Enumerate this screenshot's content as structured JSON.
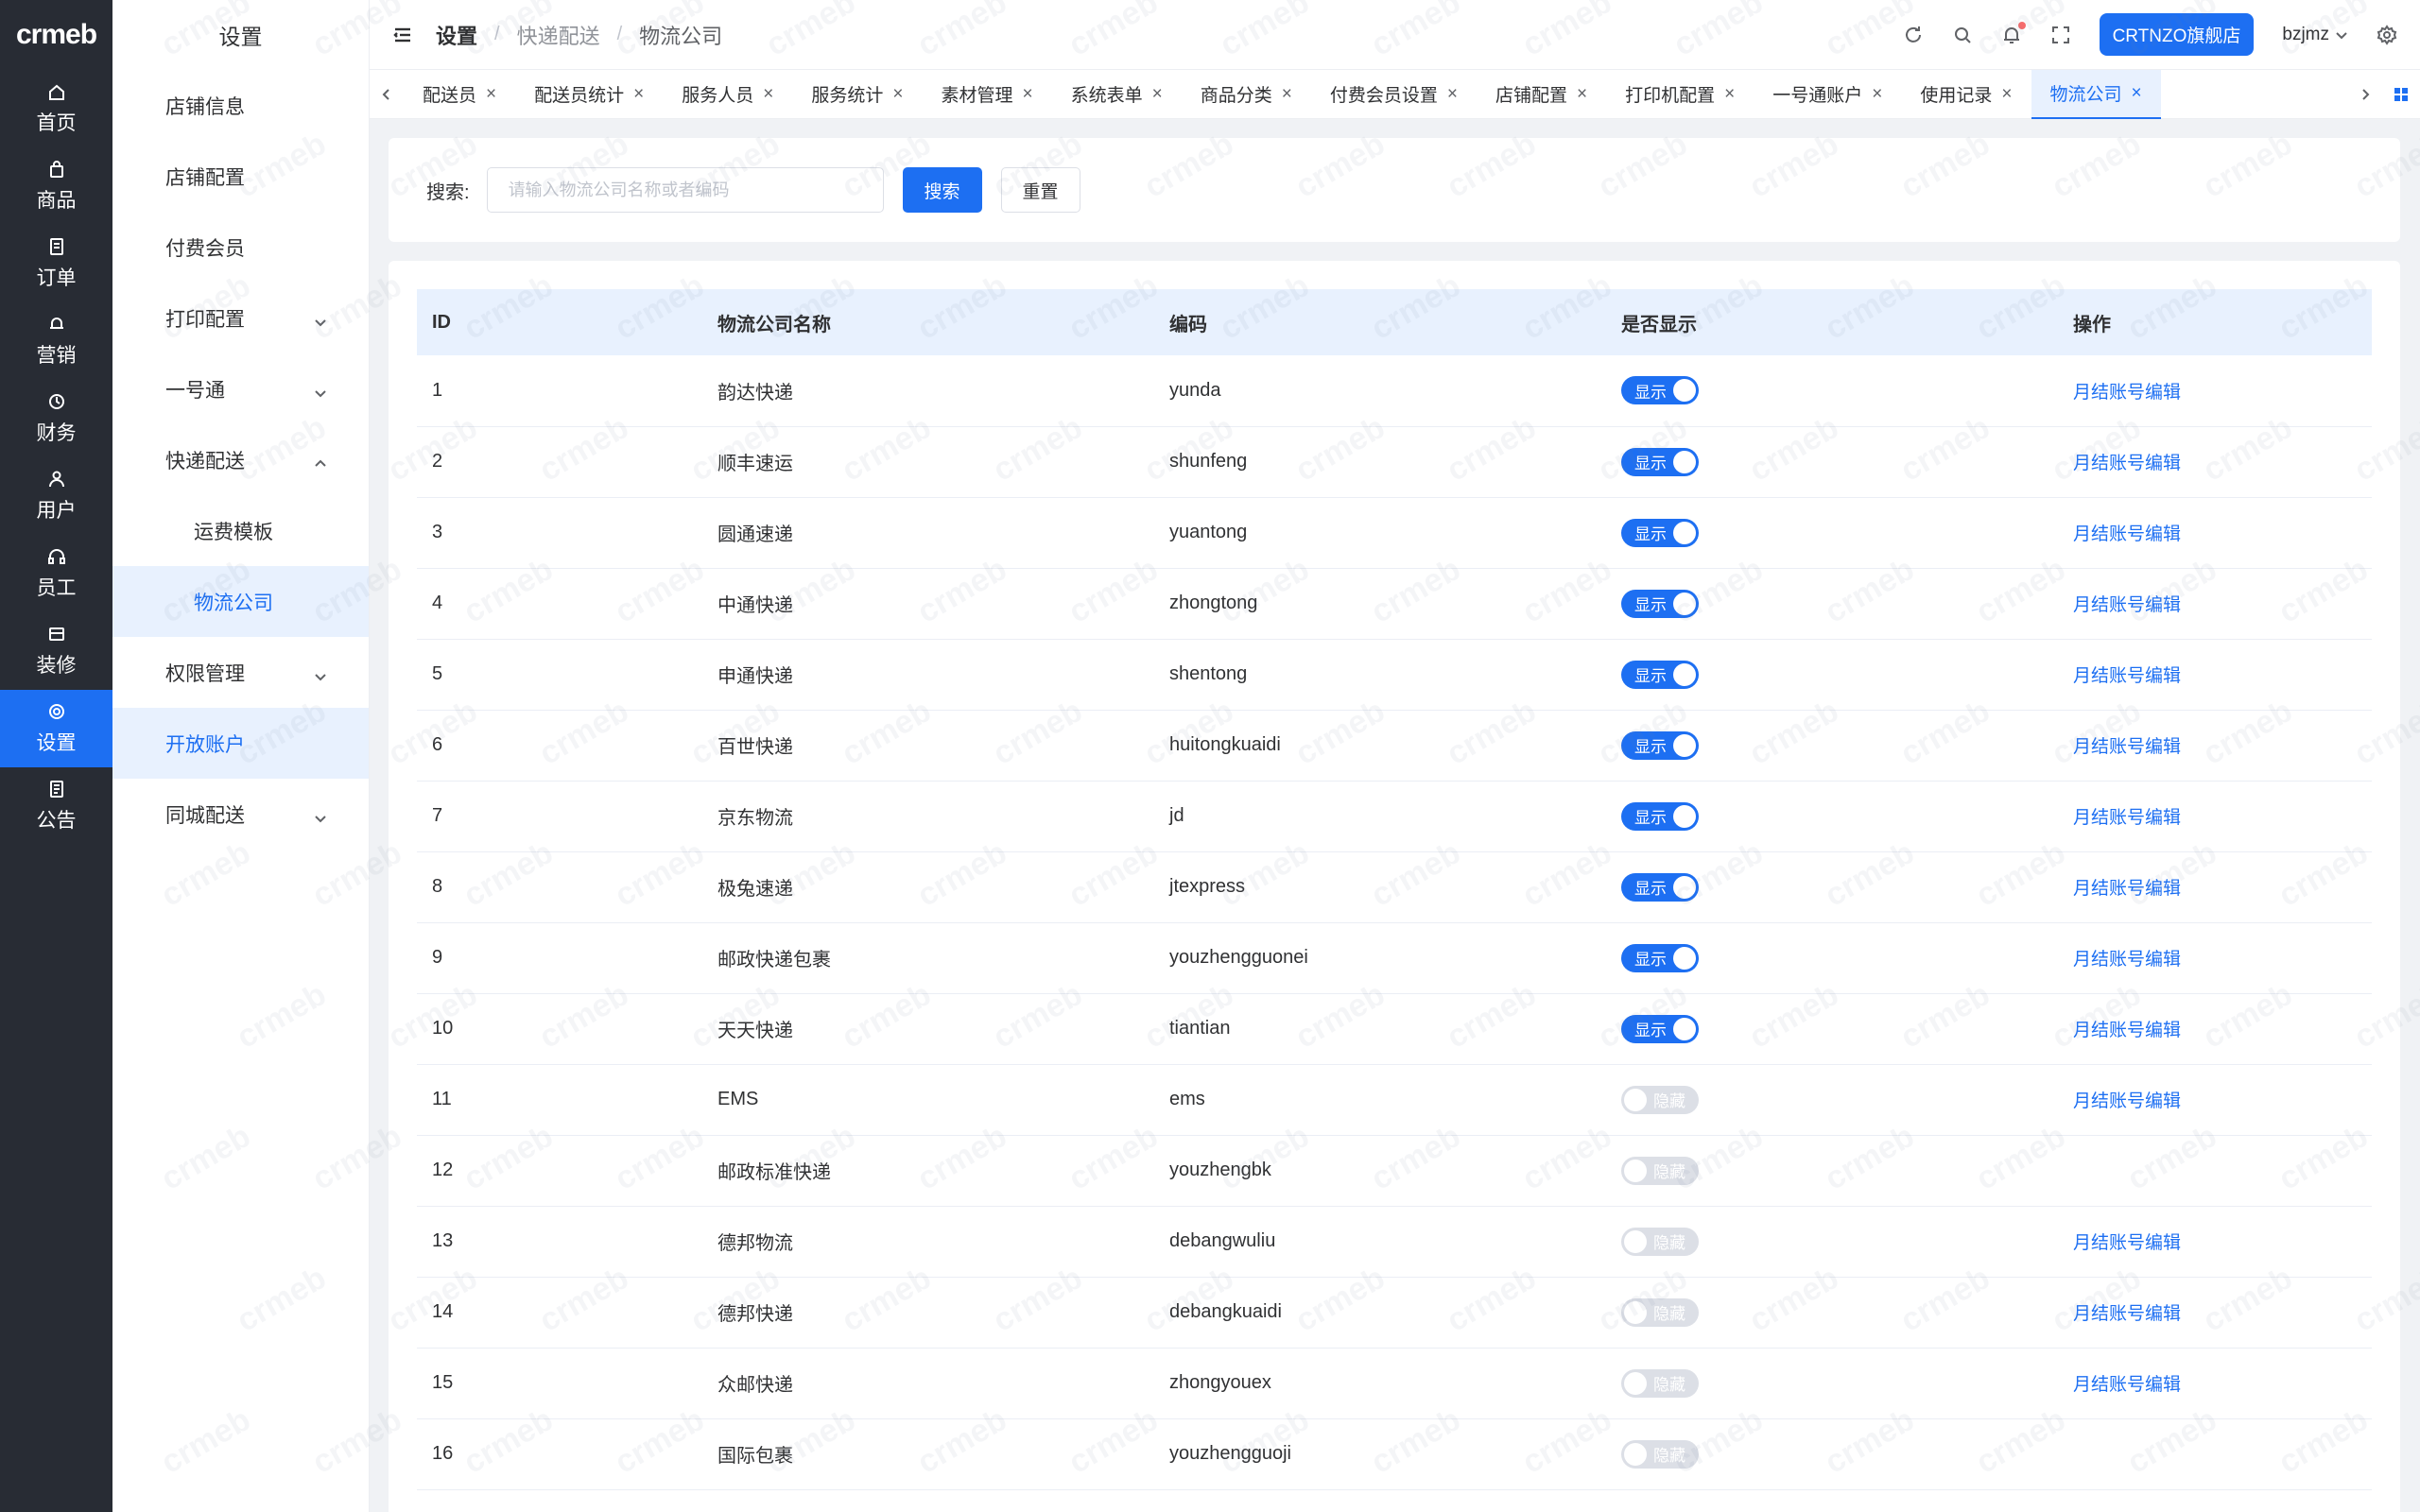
{
  "logo": "crmeb",
  "rail": [
    {
      "label": "首页",
      "icon": "home-icon"
    },
    {
      "label": "商品",
      "icon": "bag-icon"
    },
    {
      "label": "订单",
      "icon": "order-icon"
    },
    {
      "label": "营销",
      "icon": "bell-icon"
    },
    {
      "label": "财务",
      "icon": "finance-icon"
    },
    {
      "label": "用户",
      "icon": "user-icon"
    },
    {
      "label": "员工",
      "icon": "headset-icon"
    },
    {
      "label": "装修",
      "icon": "decorate-icon"
    },
    {
      "label": "设置",
      "icon": "gear-icon"
    },
    {
      "label": "公告",
      "icon": "notice-icon"
    }
  ],
  "submenu": {
    "title": "设置",
    "items": [
      {
        "label": "店铺信息"
      },
      {
        "label": "店铺配置"
      },
      {
        "label": "付费会员"
      },
      {
        "label": "打印配置"
      },
      {
        "label": "一号通"
      },
      {
        "label": "快递配送"
      },
      {
        "label": "运费模板"
      },
      {
        "label": "物流公司"
      },
      {
        "label": "权限管理"
      },
      {
        "label": "开放账户"
      },
      {
        "label": "同城配送"
      }
    ]
  },
  "header": {
    "crumbs": [
      "设置",
      "快递配送",
      "物流公司"
    ],
    "store_button": "CRTNZO旗舰店",
    "username": "bzjmz"
  },
  "tabs": [
    "配送员",
    "配送员统计",
    "服务人员",
    "服务统计",
    "素材管理",
    "系统表单",
    "商品分类",
    "付费会员设置",
    "店铺配置",
    "打印机配置",
    "一号通账户",
    "使用记录",
    "物流公司"
  ],
  "search": {
    "label": "搜索:",
    "placeholder": "请输入物流公司名称或者编码",
    "search_button": "搜索",
    "reset_button": "重置"
  },
  "table": {
    "headers": [
      "ID",
      "物流公司名称",
      "编码",
      "是否显示",
      "操作"
    ],
    "switch_on_label": "显示",
    "switch_off_label": "隐藏",
    "action_label": "月结账号编辑",
    "rows": [
      {
        "id": "1",
        "name": "韵达快递",
        "code": "yunda",
        "show": true,
        "action": true
      },
      {
        "id": "2",
        "name": "顺丰速运",
        "code": "shunfeng",
        "show": true,
        "action": true
      },
      {
        "id": "3",
        "name": "圆通速递",
        "code": "yuantong",
        "show": true,
        "action": true
      },
      {
        "id": "4",
        "name": "中通快递",
        "code": "zhongtong",
        "show": true,
        "action": true
      },
      {
        "id": "5",
        "name": "申通快递",
        "code": "shentong",
        "show": true,
        "action": true
      },
      {
        "id": "6",
        "name": "百世快递",
        "code": "huitongkuaidi",
        "show": true,
        "action": true
      },
      {
        "id": "7",
        "name": "京东物流",
        "code": "jd",
        "show": true,
        "action": true
      },
      {
        "id": "8",
        "name": "极兔速递",
        "code": "jtexpress",
        "show": true,
        "action": true
      },
      {
        "id": "9",
        "name": "邮政快递包裹",
        "code": "youzhengguonei",
        "show": true,
        "action": true
      },
      {
        "id": "10",
        "name": "天天快递",
        "code": "tiantian",
        "show": true,
        "action": true
      },
      {
        "id": "11",
        "name": "EMS",
        "code": "ems",
        "show": false,
        "action": true
      },
      {
        "id": "12",
        "name": "邮政标准快递",
        "code": "youzhengbk",
        "show": false,
        "action": false
      },
      {
        "id": "13",
        "name": "德邦物流",
        "code": "debangwuliu",
        "show": false,
        "action": true
      },
      {
        "id": "14",
        "name": "德邦快递",
        "code": "debangkuaidi",
        "show": false,
        "action": true
      },
      {
        "id": "15",
        "name": "众邮快递",
        "code": "zhongyouex",
        "show": false,
        "action": true
      },
      {
        "id": "16",
        "name": "国际包裹",
        "code": "youzhengguoji",
        "show": false,
        "action": false
      }
    ]
  },
  "colors": {
    "accent": "#1d6ff2",
    "rail_bg": "#282c34",
    "selected_bg": "#e8f1fe"
  }
}
